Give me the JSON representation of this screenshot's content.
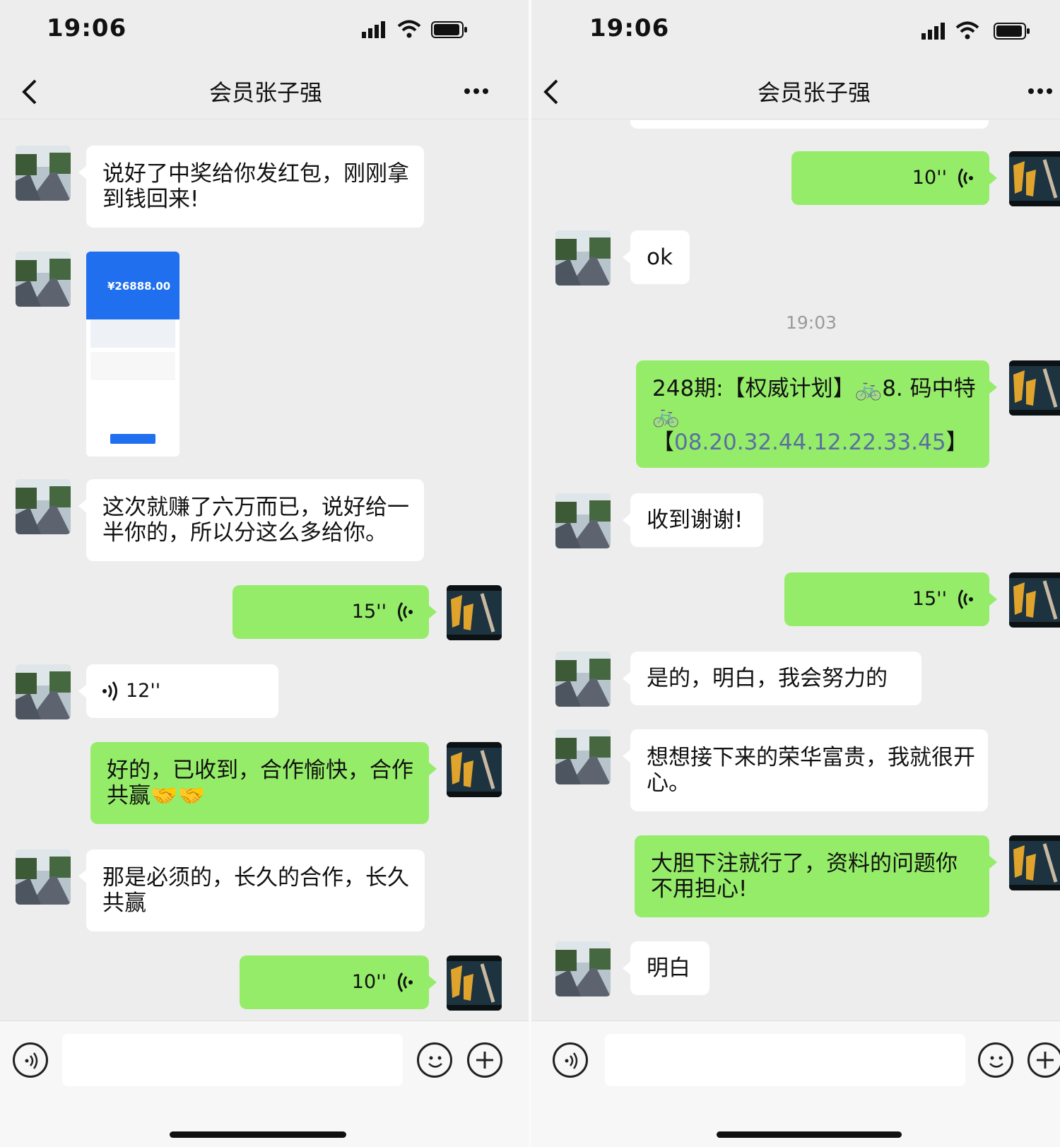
{
  "left": {
    "status": {
      "time": "19:06"
    },
    "nav": {
      "title": "会员张子强"
    },
    "messages": {
      "m1": "说好了中奖给你发红包，刚刚拿到钱回来!",
      "img_amount": "¥26888.00",
      "m2": "这次就赚了六万而已，说好给一半你的，所以分这么多给你。",
      "v1": "15''",
      "v2": "12''",
      "m3": "好的，已收到，合作愉快，合作共赢🤝🤝",
      "m4": "那是必须的，长久的合作，长久共赢",
      "v3": "10''"
    }
  },
  "right": {
    "status": {
      "time": "19:06"
    },
    "nav": {
      "title": "会员张子强"
    },
    "messages": {
      "v1": "10''",
      "m1": "ok",
      "timestamp": "19:03",
      "m2_line1": "248期:【权威计划】🚲8. 码中特",
      "m2_line2": "🚲",
      "m2_line3_open": "【",
      "m2_line3_link": "08.20.32.44.12.22.33.45",
      "m2_line3_close": "】",
      "m3": "收到谢谢!",
      "v2": "15''",
      "m4": "是的，明白，我会努力的",
      "m5": "想想接下来的荣华富贵，我就很开心。",
      "m6": "大胆下注就行了，资料的问题你不用担心!",
      "m7": "明白"
    }
  },
  "colors": {
    "sent_bubble": "#95ec69",
    "received_bubble": "#ffffff",
    "background": "#ededed"
  },
  "icons": [
    "back-icon",
    "more-icon",
    "signal-icon",
    "wifi-icon",
    "battery-icon",
    "voice-wave-icon",
    "voice-mode-icon",
    "emoji-icon",
    "plus-icon"
  ]
}
